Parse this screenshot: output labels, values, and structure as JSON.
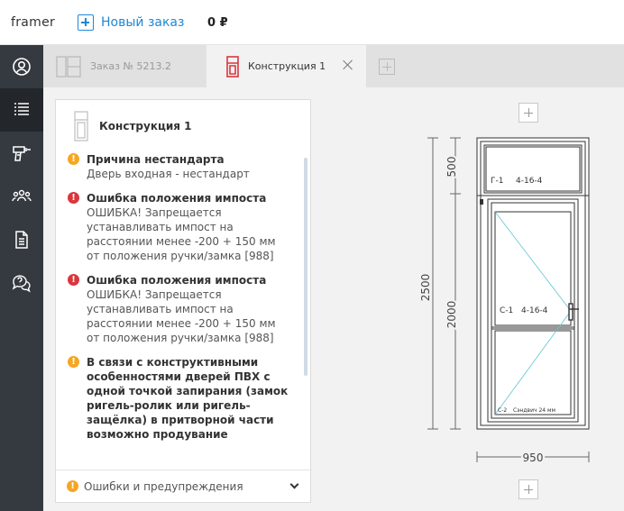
{
  "topbar": {
    "logo": "framer",
    "new_order_label": "Новый заказ",
    "price": "0 ₽"
  },
  "sidebar": {
    "items": [
      {
        "icon": "user-icon"
      },
      {
        "icon": "list-icon",
        "active": true
      },
      {
        "icon": "drill-icon"
      },
      {
        "icon": "people-icon"
      },
      {
        "icon": "document-icon"
      },
      {
        "icon": "help-chat-icon"
      }
    ]
  },
  "tabs": [
    {
      "label": "Заказ № 5213.2",
      "active": false
    },
    {
      "label": "Конструкция 1",
      "active": true
    }
  ],
  "panel": {
    "title": "Конструкция 1",
    "messages": [
      {
        "type": "warning",
        "title": "Причина нестандарта",
        "text": "Дверь входная - нестандарт"
      },
      {
        "type": "error",
        "title": "Ошибка положения импоста",
        "text": "ОШИБКА! Запрещается\nустанавливать импост на\nрасстоянии менее -200 + 150 мм\nот положения ручки/замка [988]"
      },
      {
        "type": "error",
        "title": "Ошибка положения импоста",
        "text": "ОШИБКА! Запрещается\nустанавливать импост на\nрасстоянии менее -200 + 150 мм\nот положения ручки/замка [988]"
      },
      {
        "type": "warning",
        "title": "В связи с конструктивными\nособенностями дверей ПВХ с\nодной точкой запирания (замок\nригель-ролик или ригель-\nзащёлка) в притворной части\nвозможно продувание",
        "text": ""
      }
    ],
    "footer_label": "Ошибки и предупреждения"
  },
  "drawing": {
    "dim_total_height": "2500",
    "dim_top": "500",
    "dim_bottom": "2000",
    "dim_width": "950",
    "top_pane_label": "Г-1",
    "top_pane_glass": "4-16-4",
    "door_pane_label": "С-1",
    "door_pane_glass": "4-16-4",
    "bottom_pane_label": "С-2",
    "bottom_pane_glass": "Сэндвич 24 мм"
  },
  "colors": {
    "accent": "#1e88d6",
    "warning": "#f5a623",
    "error": "#d9363e",
    "sidebar": "#353a40"
  }
}
